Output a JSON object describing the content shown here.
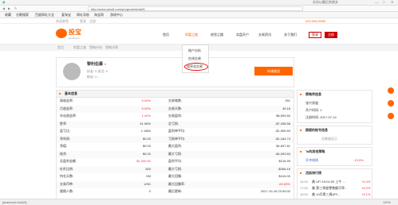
{
  "browser": {
    "url": "http://www.ytoo8.com/program/detail/1",
    "right_text": "台风以最后系统文",
    "status_url": "javascript:void(0);",
    "zoom": "110%"
  },
  "bookmarks": [
    "收藏",
    "谷歌搜索",
    "百度网址大全",
    "爱淘宝",
    "网址导航",
    "淘宝网",
    "游戏中心"
  ],
  "site": {
    "top_left": "欢迎来到",
    "login": "登录",
    "register": "注册",
    "phone": "400-966-0588"
  },
  "logo": {
    "name": "投宝",
    "url": "ytoo8.com"
  },
  "nav": [
    "首页",
    "财富之路",
    "经验之路",
    "实盘开户",
    "交易资讯",
    "关于我们"
  ],
  "nav_buttons": {
    "login": "登录",
    "register": "注册"
  },
  "dropdown": [
    "账户分析",
    "在线交易",
    "程序化交易"
  ],
  "breadcrumb": [
    "首页",
    "财富之路",
    "策略市场",
    "策略详情"
  ],
  "profile": {
    "name": "黎利伯暴",
    "line1": "好友: 0    关注: 0",
    "line2": "粉丝: 0  ...",
    "action": "申请使用"
  },
  "basic": {
    "title": "基本信息",
    "rows": [
      [
        "周收益率:",
        "0.00%",
        "交易笔数:",
        "391"
      ],
      [
        "月收益率:",
        "0.00%",
        "交易天数:",
        "45.18"
      ],
      [
        "年化收益率:",
        "1.42%",
        "交易盈利:",
        "$8,599.50"
      ],
      [
        "胜率:",
        "51.96%",
        "总亏损:",
        "-$7,258.58"
      ],
      [
        "盈亏比:",
        "1.1854",
        "盈利单平均:",
        "-$1,505.69"
      ],
      [
        "净利润:",
        "$0.00",
        "亏损单平均:",
        "-$1,164.74"
      ],
      [
        "净值:",
        "$0.00",
        "最大盈利:",
        "$4,697.81"
      ],
      [
        "结余:",
        "$0.00",
        "最大亏损:",
        "-$4,093.84"
      ],
      [
        "总盈利金额:",
        "$1,340.92",
        "盈利平均:",
        "$216.95"
      ],
      [
        "杠杆比例:",
        "500",
        "最大亏损:",
        "-$268.16"
      ],
      [
        "持仓天数:",
        "XM",
        "最大回撤:",
        "$416.00"
      ],
      [
        "交易币种:",
        "USD",
        "最大回撤率:",
        "-60.85%"
      ],
      [
        "跟随人数:",
        "0",
        "最后更新:",
        "2017-10-16 23:30:02"
      ]
    ]
  },
  "strategy": {
    "title": "策略师信息",
    "items": [
      "张兴贤道",
      "开户时间: 1",
      "注册时间: 2017-07-14"
    ]
  },
  "follow": {
    "title": "跟随的账号信息",
    "empty": "无数据显示"
  },
  "followed": {
    "title": "Ta的其他策略",
    "name": "开冲线线",
    "value": "-13.5%"
  },
  "news": {
    "title": "活跃排行榜",
    "rows": [
      [
        "16:00",
        "美 UFI 15:01:00 上午 ...",
        "+4.4%"
      ],
      [
        "17:00",
        "美 第三季度零售额月率...",
        "+8.2%"
      ],
      [
        "18:00",
        "美 10月第三周API...",
        "+4.1%"
      ]
    ]
  },
  "colors": {
    "brand": "#f60",
    "accent_red": "#e34"
  }
}
